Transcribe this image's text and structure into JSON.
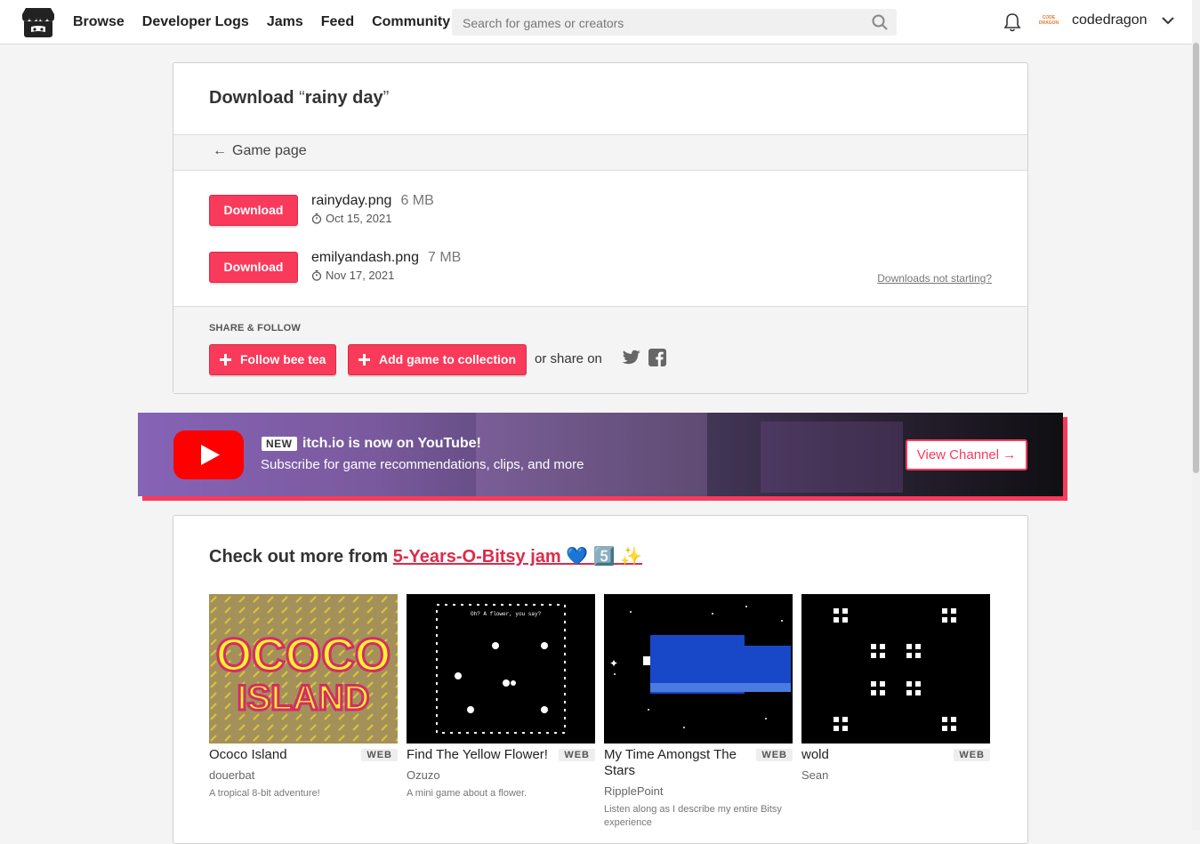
{
  "nav": {
    "items": [
      "Browse",
      "Developer Logs",
      "Jams",
      "Feed",
      "Community"
    ]
  },
  "search": {
    "placeholder": "Search for games or creators"
  },
  "user": {
    "name": "codedragon",
    "avatar_text": "CODE DRAGON"
  },
  "download": {
    "title_prefix": "Download ",
    "open_quote": "“",
    "game_name": "rainy day",
    "close_quote": "”",
    "back_label": "Game page",
    "uploads": [
      {
        "button": "Download",
        "file": "rainyday.png",
        "size": "6 MB",
        "date": "Oct 15, 2021"
      },
      {
        "button": "Download",
        "file": "emilyandash.png",
        "size": "7 MB",
        "date": "Nov 17, 2021"
      }
    ],
    "help_link": "Downloads not starting?"
  },
  "share": {
    "heading": "SHARE & FOLLOW",
    "follow_label": "Follow bee tea",
    "collection_label": "Add game to collection",
    "or_share": "or share on"
  },
  "youtube": {
    "badge": "NEW",
    "headline": "itch.io is now on YouTube!",
    "subline": "Subscribe for game recommendations, clips, and more",
    "button": "View Channel →"
  },
  "more": {
    "prefix": "Check out more from ",
    "jam_name": "5-Years-O-Bitsy jam 💙 5️⃣ ✨",
    "games": [
      {
        "title": "Ococo Island",
        "platform": "WEB",
        "author": "douerbat",
        "desc": "A tropical 8-bit adventure!",
        "thumb_text_1": "OCOCO",
        "thumb_text_2": "ISLAND"
      },
      {
        "title": "Find The Yellow Flower!",
        "platform": "WEB",
        "author": "Ozuzo",
        "desc": "A mini game about a flower.",
        "thumb_caption": "Oh? A flower, you say?"
      },
      {
        "title": "My Time Amongst The Stars",
        "platform": "WEB",
        "author": "RipplePoint",
        "desc": "Listen along as I describe my entire Bitsy experience"
      },
      {
        "title": "wold",
        "platform": "WEB",
        "author": "Sean",
        "desc": ""
      }
    ]
  },
  "colors": {
    "accent": "#fa3a5a",
    "link": "#da2c4b"
  }
}
